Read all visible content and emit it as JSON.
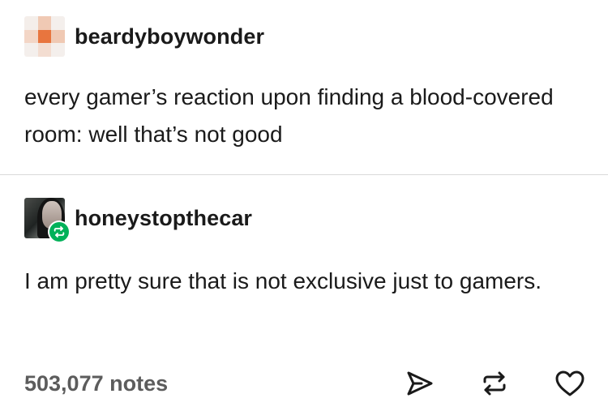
{
  "posts": [
    {
      "username": "beardyboywonder",
      "text": "every gamer’s reaction upon finding a blood-covered room: well that’s not good"
    },
    {
      "username": "honeystopthecar",
      "text": "I am pretty sure that is not exclusive just to gamers."
    }
  ],
  "footer": {
    "notes": "503,077 notes"
  },
  "icons": {
    "share": "send-icon",
    "reblog": "reblog-icon",
    "like": "heart-icon"
  },
  "colors": {
    "reblog_badge": "#00b159",
    "notes_text": "#5c5c5c",
    "divider": "#d9d9d9"
  }
}
